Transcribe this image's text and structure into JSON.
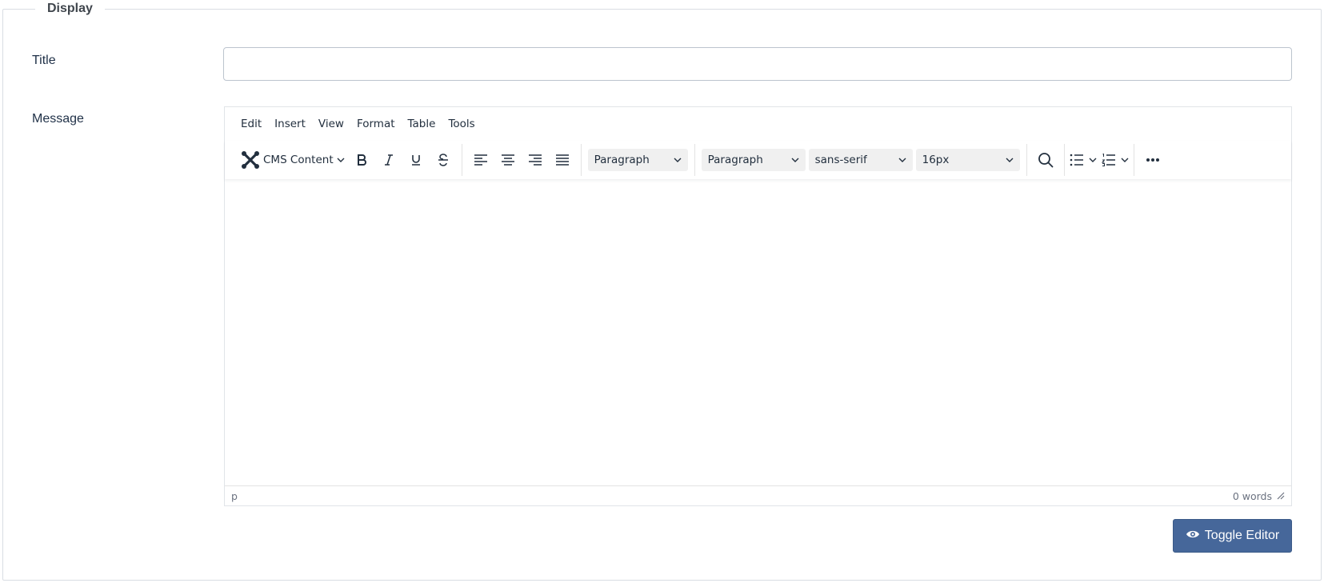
{
  "fieldset": {
    "legend": "Display"
  },
  "title_field": {
    "label": "Title",
    "value": "",
    "placeholder": ""
  },
  "message_field": {
    "label": "Message"
  },
  "editor": {
    "menu": [
      "Edit",
      "Insert",
      "View",
      "Format",
      "Table",
      "Tools"
    ],
    "toolbar": {
      "cms_label": "CMS Content",
      "block_select": "Paragraph",
      "format_select": "Paragraph",
      "font_select": "sans-serif",
      "size_select": "16px"
    },
    "statusbar": {
      "path": "p",
      "word_count": "0 words"
    }
  },
  "toggle_button": {
    "label": "Toggle Editor"
  },
  "colors": {
    "primary_button": "#46679a",
    "label_text": "#1f3047"
  }
}
